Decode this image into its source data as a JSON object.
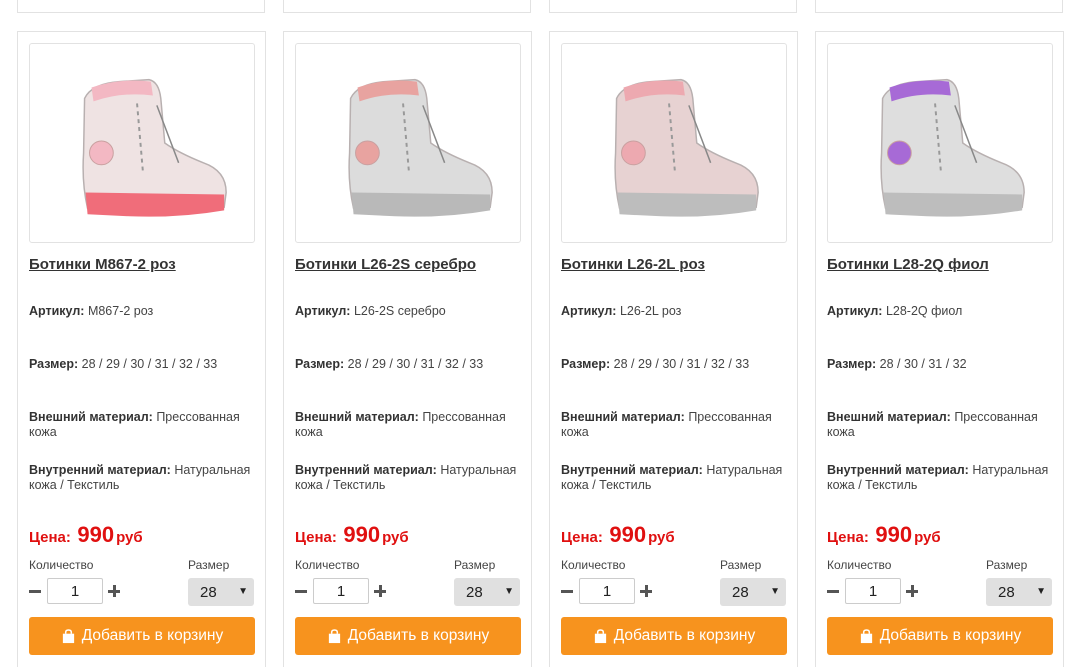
{
  "products": [
    {
      "title": "Ботинки M867-2 роз",
      "article_label": "Артикул:",
      "article": "M867-2 роз",
      "size_label": "Размер:",
      "sizes": "28 / 29 / 30 / 31 / 32 / 33",
      "outer_label": "Внешний материал:",
      "outer": "Прессованная кожа",
      "inner_label": "Внутренний материал:",
      "inner": "Натуральная кожа / Текстиль",
      "price_label": "Цена:",
      "price": "990",
      "currency": "руб",
      "qty_label": "Количество",
      "qty": "1",
      "size_select_label": "Размер",
      "size_selected": "28",
      "add_label": "Добавить в корзину",
      "image_icon": "pink-boot-image",
      "colors": {
        "body": "#efe3e3",
        "sole": "#f06d7a",
        "accent": "#f3b8c3"
      }
    },
    {
      "title": "Ботинки L26-2S серебро",
      "article_label": "Артикул:",
      "article": "L26-2S серебро",
      "size_label": "Размер:",
      "sizes": "28 / 29 / 30 / 31 / 32 / 33",
      "outer_label": "Внешний материал:",
      "outer": "Прессованная кожа",
      "inner_label": "Внутренний материал:",
      "inner": "Натуральная кожа / Текстиль",
      "price_label": "Цена:",
      "price": "990",
      "currency": "руб",
      "qty_label": "Количество",
      "qty": "1",
      "size_select_label": "Размер",
      "size_selected": "28",
      "add_label": "Добавить в корзину",
      "image_icon": "silver-boot-image",
      "colors": {
        "body": "#dcdcdc",
        "sole": "#b9b9b9",
        "accent": "#e8a3a0"
      }
    },
    {
      "title": "Ботинки L26-2L роз",
      "article_label": "Артикул:",
      "article": "L26-2L роз",
      "size_label": "Размер:",
      "sizes": "28 / 29 / 30 / 31 / 32 / 33",
      "outer_label": "Внешний материал:",
      "outer": "Прессованная кожа",
      "inner_label": "Внутренний материал:",
      "inner": "Натуральная кожа / Текстиль",
      "price_label": "Цена:",
      "price": "990",
      "currency": "руб",
      "qty_label": "Количество",
      "qty": "1",
      "size_select_label": "Размер",
      "size_selected": "28",
      "add_label": "Добавить в корзину",
      "image_icon": "rose-boot-image",
      "colors": {
        "body": "#e7d2d2",
        "sole": "#bdbdbd",
        "accent": "#eda9b0"
      }
    },
    {
      "title": "Ботинки L28-2Q фиол",
      "article_label": "Артикул:",
      "article": "L28-2Q фиол",
      "size_label": "Размер:",
      "sizes": "28 / 30 / 31 / 32",
      "outer_label": "Внешний материал:",
      "outer": "Прессованная кожа",
      "inner_label": "Внутренний материал:",
      "inner": "Натуральная кожа / Текстиль",
      "price_label": "Цена:",
      "price": "990",
      "currency": "руб",
      "qty_label": "Количество",
      "qty": "1",
      "size_select_label": "Размер",
      "size_selected": "28",
      "add_label": "Добавить в корзину",
      "image_icon": "violet-boot-image",
      "colors": {
        "body": "#dedede",
        "sole": "#bdbdbd",
        "accent": "#a76ad6"
      }
    }
  ],
  "theme": {
    "button_color": "#f7931e",
    "price_color": "#e01010"
  }
}
